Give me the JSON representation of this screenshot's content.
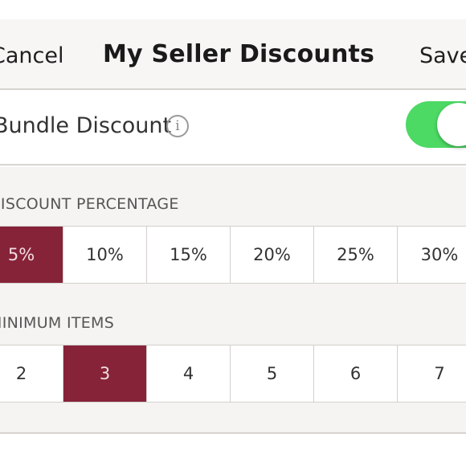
{
  "header": {
    "cancel_label": "Cancel",
    "title": "My Seller Discounts",
    "save_label": "Save"
  },
  "bundle": {
    "label": "Bundle Discount",
    "info_icon": "i",
    "toggle_on": true,
    "toggle_color": "#4cd964"
  },
  "discount_percentage": {
    "label": "DISCOUNT PERCENTAGE",
    "options": [
      "5%",
      "10%",
      "15%",
      "20%",
      "25%",
      "30%"
    ],
    "selected": "5%"
  },
  "minimum_items": {
    "label": "MINIMUM ITEMS",
    "options": [
      "2",
      "3",
      "4",
      "5",
      "6",
      "7"
    ],
    "selected": "3"
  },
  "colors": {
    "selected_bg": "#862339",
    "background": "#f5f4f2"
  }
}
